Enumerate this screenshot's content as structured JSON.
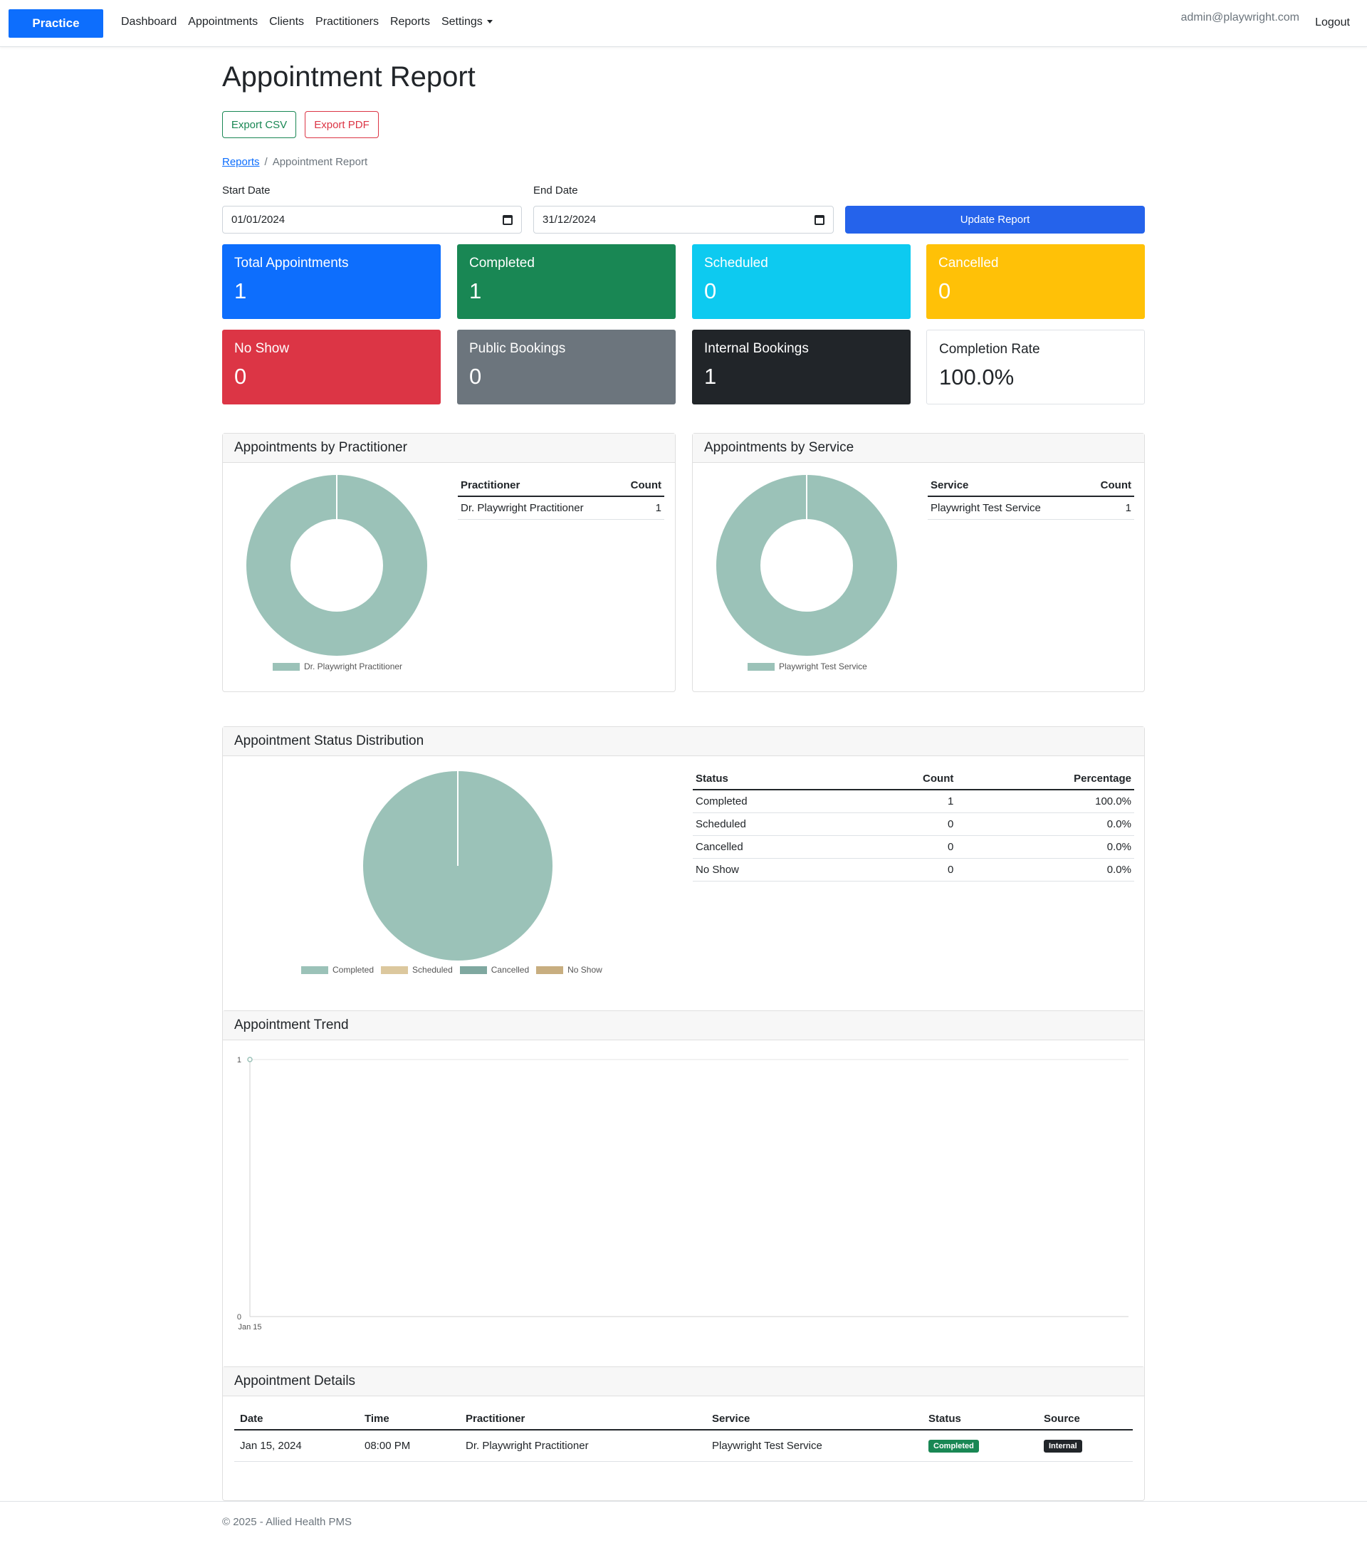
{
  "nav": {
    "brand": "Practice",
    "links": [
      "Dashboard",
      "Appointments",
      "Clients",
      "Practitioners",
      "Reports",
      "Settings"
    ],
    "user": "admin@playwright.com",
    "logout": "Logout"
  },
  "page": {
    "title": "Appointment Report",
    "export_csv": "Export CSV",
    "export_pdf": "Export PDF",
    "breadcrumb": {
      "parent": "Reports",
      "separator": "/",
      "current": "Appointment Report"
    }
  },
  "filters": {
    "start_label": "Start Date",
    "start_value": "01/01/2024",
    "end_label": "End Date",
    "end_value": "31/12/2024",
    "update_button": "Update Report"
  },
  "stats": [
    {
      "title": "Total Appointments",
      "value": "1",
      "bg": "#0d6efd",
      "fg": "#ffffff"
    },
    {
      "title": "Completed",
      "value": "1",
      "bg": "#198754",
      "fg": "#ffffff"
    },
    {
      "title": "Scheduled",
      "value": "0",
      "bg": "#0dcaf0",
      "fg": "#ffffff"
    },
    {
      "title": "Cancelled",
      "value": "0",
      "bg": "#ffc107",
      "fg": "#ffffff"
    },
    {
      "title": "No Show",
      "value": "0",
      "bg": "#dc3545",
      "fg": "#ffffff"
    },
    {
      "title": "Public Bookings",
      "value": "0",
      "bg": "#6c757d",
      "fg": "#ffffff"
    },
    {
      "title": "Internal Bookings",
      "value": "1",
      "bg": "#212529",
      "fg": "#ffffff"
    },
    {
      "title": "Completion Rate",
      "value": "100.0%",
      "bg": "#ffffff",
      "fg": "#212529"
    }
  ],
  "by_practitioner": {
    "title": "Appointments by Practitioner",
    "headers": [
      "Practitioner",
      "Count"
    ],
    "rows": [
      [
        "Dr. Playwright Practitioner",
        "1"
      ]
    ],
    "legend": [
      "Dr. Playwright Practitioner"
    ]
  },
  "by_service": {
    "title": "Appointments by Service",
    "headers": [
      "Service",
      "Count"
    ],
    "rows": [
      [
        "Playwright Test Service",
        "1"
      ]
    ],
    "legend": [
      "Playwright Test Service"
    ]
  },
  "status_distribution": {
    "title": "Appointment Status Distribution",
    "headers": [
      "Status",
      "Count",
      "Percentage"
    ],
    "rows": [
      [
        "Completed",
        "1",
        "100.0%"
      ],
      [
        "Scheduled",
        "0",
        "0.0%"
      ],
      [
        "Cancelled",
        "0",
        "0.0%"
      ],
      [
        "No Show",
        "0",
        "0.0%"
      ]
    ],
    "legend": [
      "Completed",
      "Scheduled",
      "Cancelled",
      "No Show"
    ]
  },
  "trend": {
    "title": "Appointment Trend",
    "y_ticks": [
      "1",
      "0"
    ],
    "x_ticks": [
      "Jan 15"
    ]
  },
  "details": {
    "title": "Appointment Details",
    "headers": [
      "Date",
      "Time",
      "Practitioner",
      "Service",
      "Status",
      "Source"
    ],
    "rows": [
      {
        "date": "Jan 15, 2024",
        "time": "08:00 PM",
        "practitioner": "Dr. Playwright Practitioner",
        "service": "Playwright Test Service",
        "status": "Completed",
        "source": "Internal"
      }
    ]
  },
  "footer": "© 2025 - Allied Health PMS",
  "colors": {
    "pie_1": "#9bc2b8",
    "pie_2": "#dcc89e",
    "pie_3": "#7fa8a0",
    "pie_4": "#c8ae80",
    "badge_completed": "#198754",
    "badge_internal": "#212529"
  },
  "chart_data": [
    {
      "type": "pie",
      "categories": [
        "Dr. Playwright Practitioner"
      ],
      "values": [
        1
      ]
    },
    {
      "type": "pie",
      "categories": [
        "Playwright Test Service"
      ],
      "values": [
        1
      ]
    },
    {
      "type": "pie",
      "categories": [
        "Completed",
        "Scheduled",
        "Cancelled",
        "No Show"
      ],
      "values": [
        1,
        0,
        0,
        0
      ]
    },
    {
      "type": "line",
      "x": [
        "Jan 15"
      ],
      "values": [
        1
      ],
      "ylim": [
        0,
        1
      ],
      "grid": true
    }
  ]
}
